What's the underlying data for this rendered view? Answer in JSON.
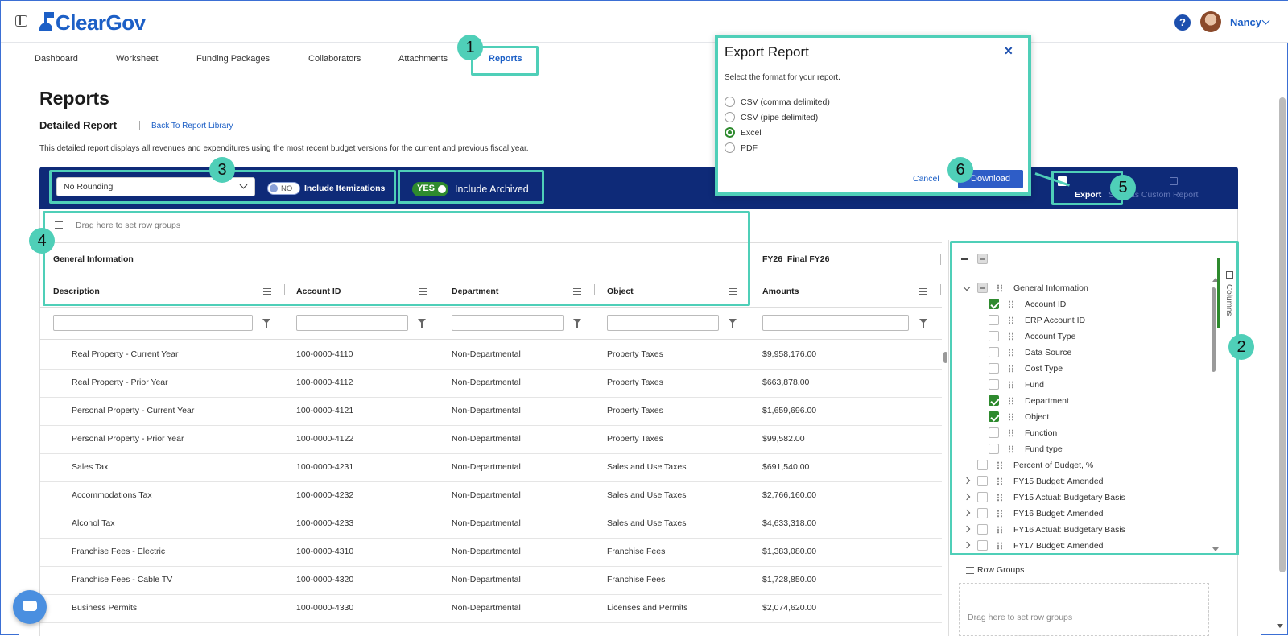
{
  "app": {
    "logo": "ClearGov",
    "user_name": "Nancy",
    "help_label": "?"
  },
  "tabs": [
    "Dashboard",
    "Worksheet",
    "Funding Packages",
    "Collaborators",
    "Attachments",
    "Reports"
  ],
  "page": {
    "title": "Reports",
    "subtitle": "Detailed Report",
    "back_link": "Back To Report Library",
    "description": "This detailed report displays all revenues and expenditures using the most recent budget versions for the current and previous fiscal year."
  },
  "toolbar": {
    "rounding_value": "No Rounding",
    "itemizations_toggle": "NO",
    "itemizations_label": "Include Itemizations",
    "archived_toggle": "YES",
    "archived_label": "Include Archived",
    "export_label": "Export",
    "save_custom_label": "Save as Custom Report"
  },
  "grid": {
    "drag_row_groups": "Drag here to set row groups",
    "group_header_left": "General Information",
    "group_header_right": "FY26  Final FY26",
    "columns": [
      "Description",
      "Account ID",
      "Department",
      "Object",
      "Amounts"
    ],
    "rows": [
      [
        "Real Property - Current Year",
        "100-0000-4110",
        "Non-Departmental",
        "Property Taxes",
        "$9,958,176.00"
      ],
      [
        "Real Property - Prior Year",
        "100-0000-4112",
        "Non-Departmental",
        "Property Taxes",
        "$663,878.00"
      ],
      [
        "Personal Property - Current Year",
        "100-0000-4121",
        "Non-Departmental",
        "Property Taxes",
        "$1,659,696.00"
      ],
      [
        "Personal Property - Prior Year",
        "100-0000-4122",
        "Non-Departmental",
        "Property Taxes",
        "$99,582.00"
      ],
      [
        "Sales Tax",
        "100-0000-4231",
        "Non-Departmental",
        "Sales and Use Taxes",
        "$691,540.00"
      ],
      [
        "Accommodations Tax",
        "100-0000-4232",
        "Non-Departmental",
        "Sales and Use Taxes",
        "$2,766,160.00"
      ],
      [
        "Alcohol Tax",
        "100-0000-4233",
        "Non-Departmental",
        "Sales and Use Taxes",
        "$4,633,318.00"
      ],
      [
        "Franchise Fees - Electric",
        "100-0000-4310",
        "Non-Departmental",
        "Franchise Fees",
        "$1,383,080.00"
      ],
      [
        "Franchise Fees - Cable TV",
        "100-0000-4320",
        "Non-Departmental",
        "Franchise Fees",
        "$1,728,850.00"
      ],
      [
        "Business Permits",
        "100-0000-4330",
        "Non-Departmental",
        "Licenses and Permits",
        "$2,074,620.00"
      ]
    ]
  },
  "columns_panel": {
    "tab_label": "Columns",
    "items": [
      {
        "label": "General Information",
        "state": "partial",
        "expandable": true,
        "expanded": true,
        "indent": 0
      },
      {
        "label": "Account ID",
        "state": "checked",
        "indent": 1
      },
      {
        "label": "ERP Account ID",
        "state": "unchecked",
        "indent": 1
      },
      {
        "label": "Account Type",
        "state": "unchecked",
        "indent": 1
      },
      {
        "label": "Data Source",
        "state": "unchecked",
        "indent": 1
      },
      {
        "label": "Cost Type",
        "state": "unchecked",
        "indent": 1
      },
      {
        "label": "Fund",
        "state": "unchecked",
        "indent": 1
      },
      {
        "label": "Department",
        "state": "checked",
        "indent": 1
      },
      {
        "label": "Object",
        "state": "checked",
        "indent": 1
      },
      {
        "label": "Function",
        "state": "unchecked",
        "indent": 1
      },
      {
        "label": "Fund type",
        "state": "unchecked",
        "indent": 1
      },
      {
        "label": "Percent of Budget, %",
        "state": "unchecked",
        "indent": 0
      },
      {
        "label": "FY15 Budget: Amended",
        "state": "unchecked",
        "expandable": true,
        "indent": 0
      },
      {
        "label": "FY15 Actual: Budgetary Basis",
        "state": "unchecked",
        "expandable": true,
        "indent": 0
      },
      {
        "label": "FY16 Budget: Amended",
        "state": "unchecked",
        "expandable": true,
        "indent": 0
      },
      {
        "label": "FY16 Actual: Budgetary Basis",
        "state": "unchecked",
        "expandable": true,
        "indent": 0
      },
      {
        "label": "FY17 Budget: Amended",
        "state": "unchecked",
        "expandable": true,
        "indent": 0
      }
    ],
    "row_groups_label": "Row Groups",
    "row_groups_drop": "Drag here to set row groups"
  },
  "export_modal": {
    "title": "Export Report",
    "prompt": "Select the format for your report.",
    "options": [
      "CSV (comma delimited)",
      "CSV (pipe delimited)",
      "Excel",
      "PDF"
    ],
    "selected": "Excel",
    "cancel_label": "Cancel",
    "download_label": "Download",
    "close_label": "✕"
  },
  "callouts": [
    "1",
    "2",
    "3",
    "4",
    "5",
    "6"
  ],
  "colors": {
    "brand_blue": "#1c5fc6",
    "toolbar_navy": "#0e2a78",
    "highlight_teal": "#4fcfb8",
    "check_green": "#2e8a2e"
  }
}
